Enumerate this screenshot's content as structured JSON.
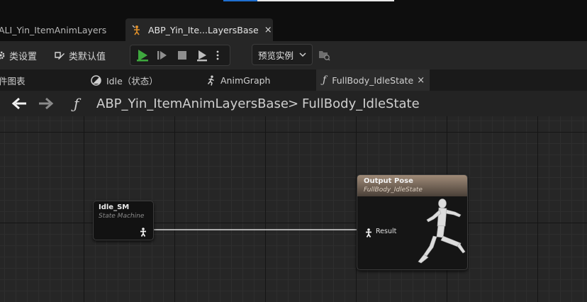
{
  "doc_tabs": [
    {
      "label": "ALI_Yin_ItemAnimLayers"
    },
    {
      "label": "ABP_Yin_Ite...LayersBase",
      "close": "×"
    }
  ],
  "toolbar": {
    "class_settings": "类设置",
    "class_defaults": "类默认值",
    "preview_instance": "预览实例"
  },
  "graph_tabs": [
    {
      "label": "件图表"
    },
    {
      "label": "Idle（状态）"
    },
    {
      "label": "AnimGraph"
    },
    {
      "label": "FullBody_IdleState",
      "close": "×"
    }
  ],
  "breadcrumb": {
    "function_glyph": "ƒ",
    "parent": "ABP_Yin_ItemAnimLayersBase",
    "separator": ">",
    "current": "FullBody_IdleState"
  },
  "nodes": {
    "idle_sm": {
      "title": "Idle_SM",
      "subtitle": "State Machine"
    },
    "output_pose": {
      "title": "Output Pose",
      "subtitle": "FullBody_IdleState",
      "pin_label": "Result"
    }
  },
  "colors": {
    "play_green": "#3ea83e",
    "accent_blue": "#1f6fd0",
    "node_header": "#8e7a68"
  }
}
